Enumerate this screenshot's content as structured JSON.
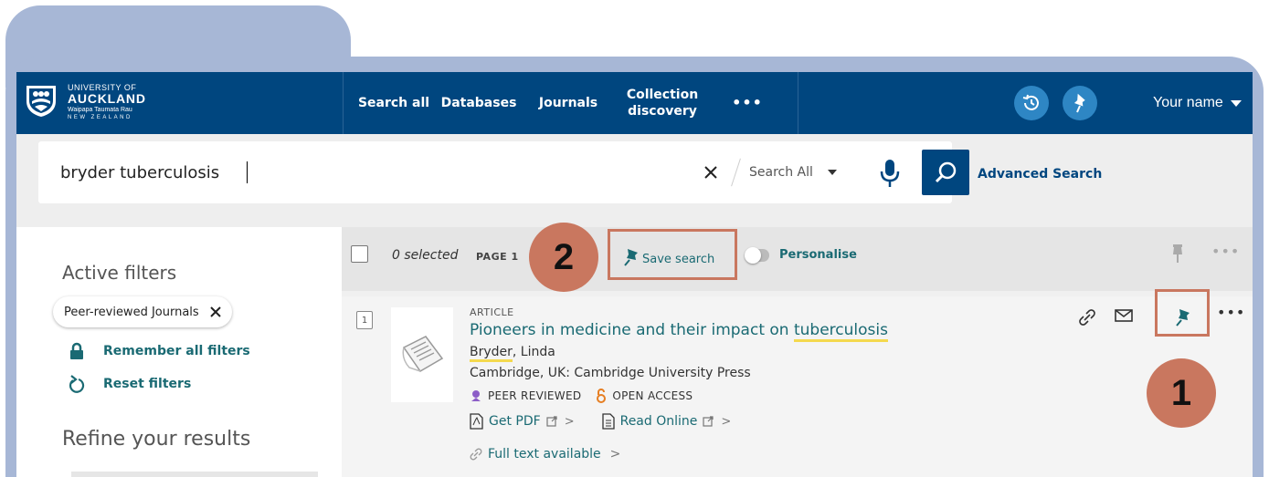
{
  "header": {
    "logo": {
      "line1": "UNIVERSITY OF",
      "line2": "AUCKLAND",
      "line3": "Waipapa Taumata Rau",
      "line4": "NEW ZEALAND"
    },
    "nav": [
      {
        "label": "Search all"
      },
      {
        "label": "Databases"
      },
      {
        "label": "Journals"
      },
      {
        "label": "Collection\ndiscovery"
      },
      {
        "label": "•••"
      }
    ],
    "user_label": "Your name",
    "icons": [
      "history-icon",
      "pin-icon",
      "chevron-down-icon"
    ]
  },
  "search": {
    "query": "bryder tuberculosis",
    "scope": "Search All",
    "advanced_label": "Advanced Search"
  },
  "filters": {
    "active_title": "Active filters",
    "chip_label": "Peer-reviewed Journals",
    "remember_label": "Remember all filters",
    "reset_label": "Reset filters",
    "refine_title": "Refine your results"
  },
  "toolbar": {
    "selected_label": "0 selected",
    "page_label": "PAGE 1",
    "save_search_label": "Save search",
    "personalise_label": "Personalise",
    "more_label": "•••"
  },
  "result": {
    "index": "1",
    "type": "ARTICLE",
    "title_before": "Pioneers in medicine and their impact on ",
    "title_highlight": "tuberculosis",
    "author_highlight": "Bryder",
    "author_rest": ", Linda",
    "publisher": "Cambridge, UK: Cambridge University Press",
    "peer_reviewed": "PEER REVIEWED",
    "open_access": "OPEN ACCESS",
    "get_pdf": "Get PDF",
    "read_online": "Read Online",
    "full_text": "Full text available",
    "more_label": "•••"
  },
  "callouts": {
    "one": "1",
    "two": "2"
  },
  "colors": {
    "header_bg": "#00467f",
    "accent_teal": "#1a6a73",
    "callout": "#c9775f",
    "frame": "#a7b7d6",
    "highlight": "#f4d94e"
  }
}
